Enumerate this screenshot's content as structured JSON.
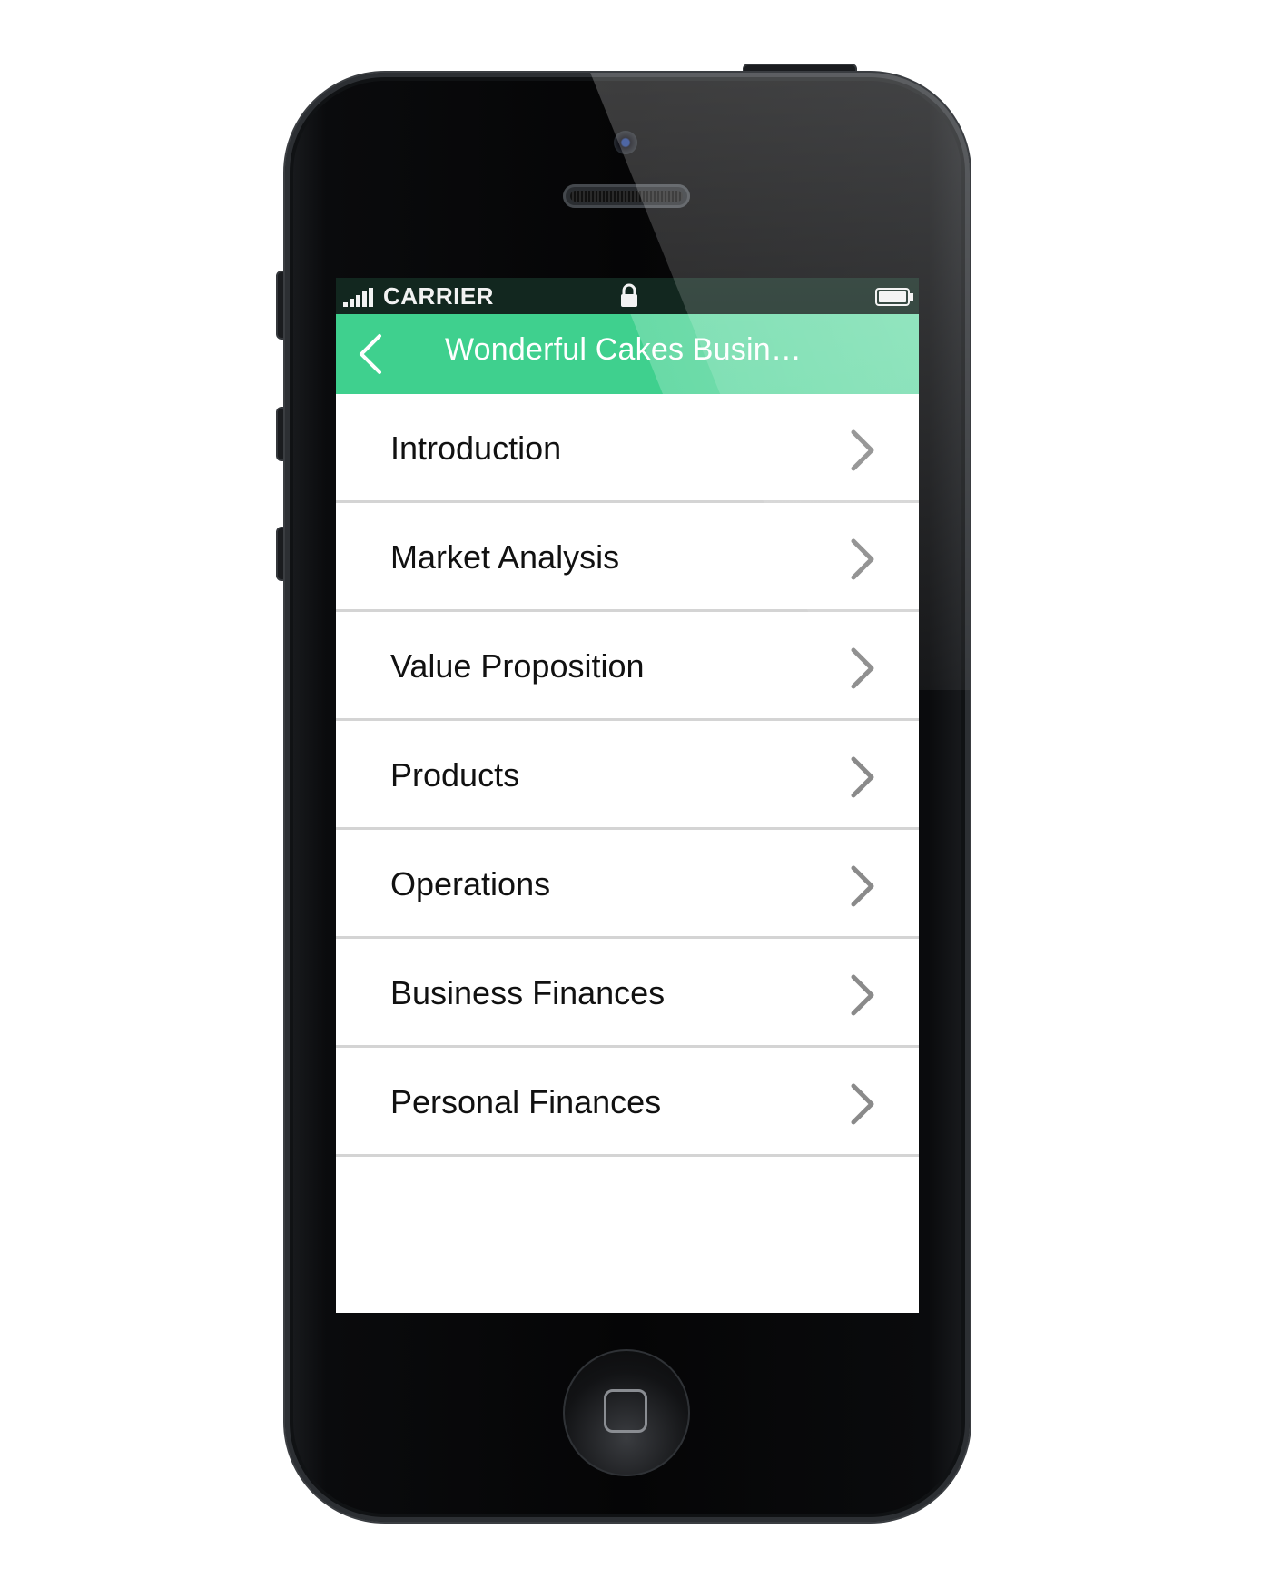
{
  "status_bar": {
    "carrier": "CARRIER",
    "signal_icon": "signal-bars-icon",
    "lock_icon": "lock-icon",
    "battery_icon": "battery-icon"
  },
  "nav_bar": {
    "title": "Wonderful Cakes Busin…",
    "back_icon": "chevron-left-icon",
    "background_color": "#3fd08e"
  },
  "menu": {
    "items": [
      {
        "label": "Introduction"
      },
      {
        "label": "Market Analysis"
      },
      {
        "label": "Value Proposition"
      },
      {
        "label": "Products"
      },
      {
        "label": "Operations"
      },
      {
        "label": "Business Finances"
      },
      {
        "label": "Personal Finances"
      }
    ],
    "chevron_icon": "chevron-right-icon"
  },
  "colors": {
    "accent": "#3fd08e",
    "status_bar": "#12271f",
    "divider": "#d4d4d4",
    "chevron": "#8a8a8a"
  }
}
